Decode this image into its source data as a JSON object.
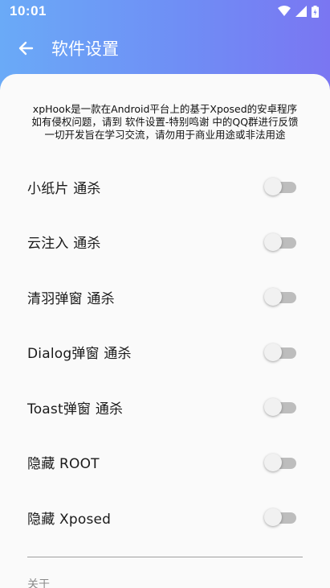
{
  "status_bar": {
    "time": "10:01"
  },
  "app_bar": {
    "title": "软件设置"
  },
  "notice": {
    "lines": [
      "xpHook是一款在Android平台上的基于Xposed的安卓程序",
      "如有侵权问题，请到 软件设置-特别鸣谢 中的QQ群进行反馈",
      "一切开发旨在学习交流，请勿用于商业用途或非法用途"
    ]
  },
  "settings": [
    {
      "label": "小纸片 通杀",
      "enabled": false
    },
    {
      "label": "云注入 通杀",
      "enabled": false
    },
    {
      "label": "清羽弹窗 通杀",
      "enabled": false
    },
    {
      "label": "Dialog弹窗 通杀",
      "enabled": false
    },
    {
      "label": "Toast弹窗 通杀",
      "enabled": false
    },
    {
      "label": "隐藏 ROOT",
      "enabled": false
    },
    {
      "label": "隐藏 Xposed",
      "enabled": false
    }
  ],
  "section": {
    "title": "关于"
  },
  "colors": {
    "header_start": "#6aaaf7",
    "header_end": "#7a76f2",
    "switch_track_off": "#bdbdbd"
  }
}
